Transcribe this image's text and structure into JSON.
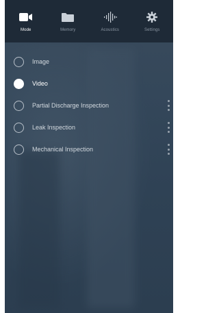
{
  "tabs": [
    {
      "label": "Mode",
      "icon": "video-camera-icon",
      "active": true
    },
    {
      "label": "Memory",
      "icon": "folder-icon",
      "active": false
    },
    {
      "label": "Acoustics",
      "icon": "sound-wave-icon",
      "active": false
    },
    {
      "label": "Settings",
      "icon": "gear-icon",
      "active": false
    }
  ],
  "modes": [
    {
      "label": "Image",
      "selected": false,
      "has_menu": false
    },
    {
      "label": "Video",
      "selected": true,
      "has_menu": false
    },
    {
      "label": "Partial Discharge Inspection",
      "selected": false,
      "has_menu": true
    },
    {
      "label": "Leak Inspection",
      "selected": false,
      "has_menu": true
    },
    {
      "label": "Mechanical Inspection",
      "selected": false,
      "has_menu": true
    }
  ],
  "colors": {
    "top_bar": "#1e2a37",
    "active_tab": "#ffffff",
    "inactive_tab": "#8c97a3",
    "panel": "#34475a"
  }
}
